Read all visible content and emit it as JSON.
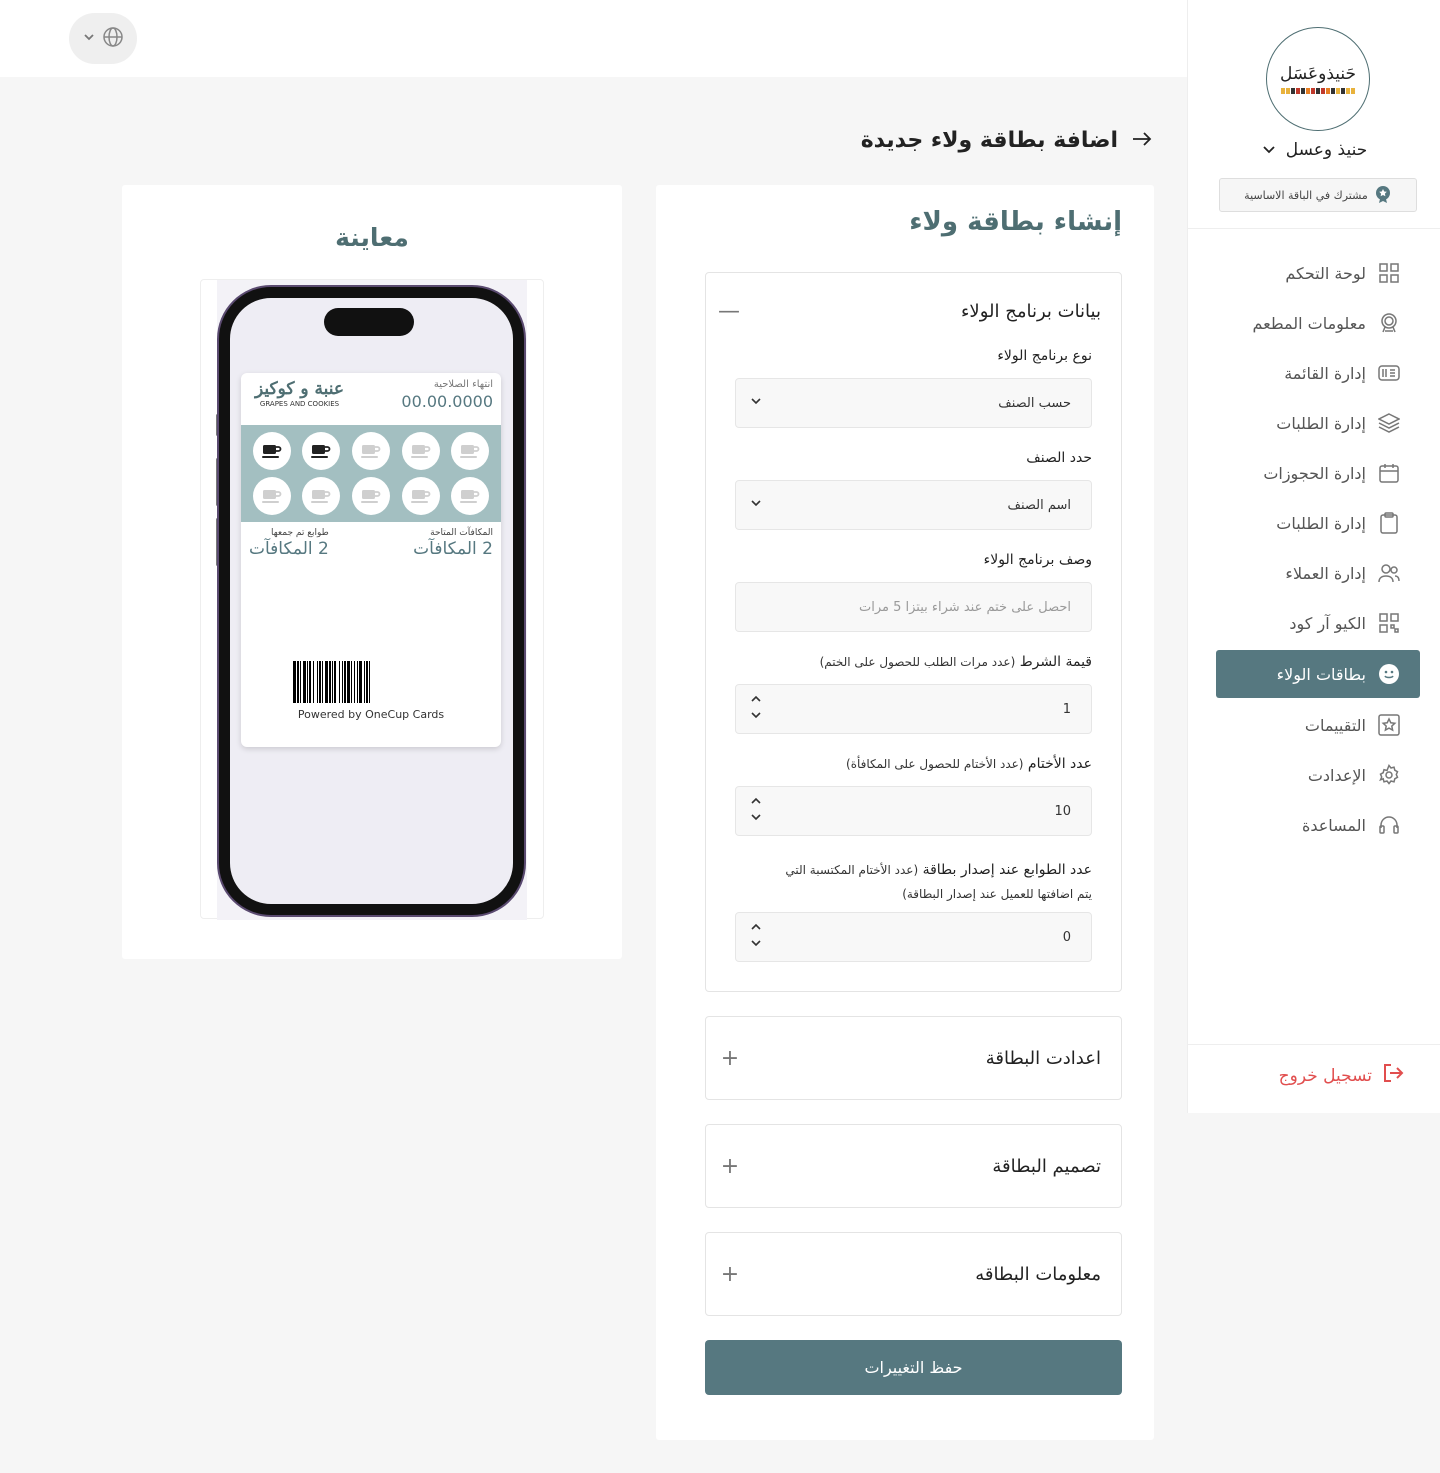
{
  "brand": {
    "name": "حنيذ وعسل",
    "logo_text": "حَنيذوعَسَل",
    "plan": "مشترك في الباقة الاساسية"
  },
  "nav": [
    {
      "label": "لوحة التحكم",
      "icon": "dashboard-icon"
    },
    {
      "label": "معلومات المطعم",
      "icon": "restaurant-icon"
    },
    {
      "label": "إدارة القائمة",
      "icon": "menu-icon"
    },
    {
      "label": "إدارة الطلبات",
      "icon": "layers-icon"
    },
    {
      "label": "إدارة الحجوزات",
      "icon": "calendar-icon"
    },
    {
      "label": "إدارة الطلبات",
      "icon": "clipboard-icon"
    },
    {
      "label": "إدارة العملاء",
      "icon": "users-icon"
    },
    {
      "label": "الكيو آر كود",
      "icon": "qr-icon"
    },
    {
      "label": "بطاقات الولاء",
      "icon": "smile-icon",
      "active": true
    },
    {
      "label": "التقييمات",
      "icon": "star-icon"
    },
    {
      "label": "الإعدادت",
      "icon": "gear-icon"
    },
    {
      "label": "المساعدة",
      "icon": "headset-icon"
    }
  ],
  "logout": "تسجيل خروج",
  "page": {
    "title": "اضافة بطاقة ولاء جديدة"
  },
  "form": {
    "title": "إنشاء بطاقة ولاء",
    "section1": {
      "title": "بيانات برنامج الولاء",
      "type_label": "نوع برنامج الولاء",
      "type_value": "حسب الصنف",
      "item_label": "حدد الصنف",
      "item_value": "اسم الصنف",
      "desc_label": "وصف برنامج الولاء",
      "desc_placeholder": "احصل على ختم عند شراء بيتزا 5 مرات",
      "cond_label": "قيمة الشرط",
      "cond_note": "(عدد مرات الطلب للحصول على الختم)",
      "cond_value": "1",
      "stamps_label": "عدد الأختام",
      "stamps_note": "(عدد الأختام للحصول على المكافأة)",
      "stamps_value": "10",
      "issue_label": "عدد الطوابع عند إصدار بطاقة",
      "issue_note1": "(عدد الأختام المكتسبة التي",
      "issue_note2": "يتم اضافتها للعميل عند إصدار البطاقة)",
      "issue_value": "0"
    },
    "section2": "اعدادت البطاقة",
    "section3": "تصميم البطاقة",
    "section4": "معلومات البطاقه",
    "save": "حفظ التغييرات"
  },
  "preview": {
    "title": "معاينة",
    "brand_ar": "عنبة و كوكيز",
    "brand_en": "GRAPES AND COOKIES",
    "expiry_label": "انتهاء الصلاحية",
    "expiry_value": "00.00.0000",
    "rewards_label": "المكافآت المتاحة",
    "rewards_value": "2 المكافآت",
    "collected_label": "طوابع تم جمعها",
    "collected_value": "2 المكافآت",
    "stamps_filled": 2,
    "stamps_total": 10,
    "powered": "Powered by OneCup Cards"
  },
  "colors": {
    "accent": "#567880",
    "title": "#4e6e72",
    "logout": "#e14e4e",
    "stamp_bg": "#a3bfc1"
  }
}
